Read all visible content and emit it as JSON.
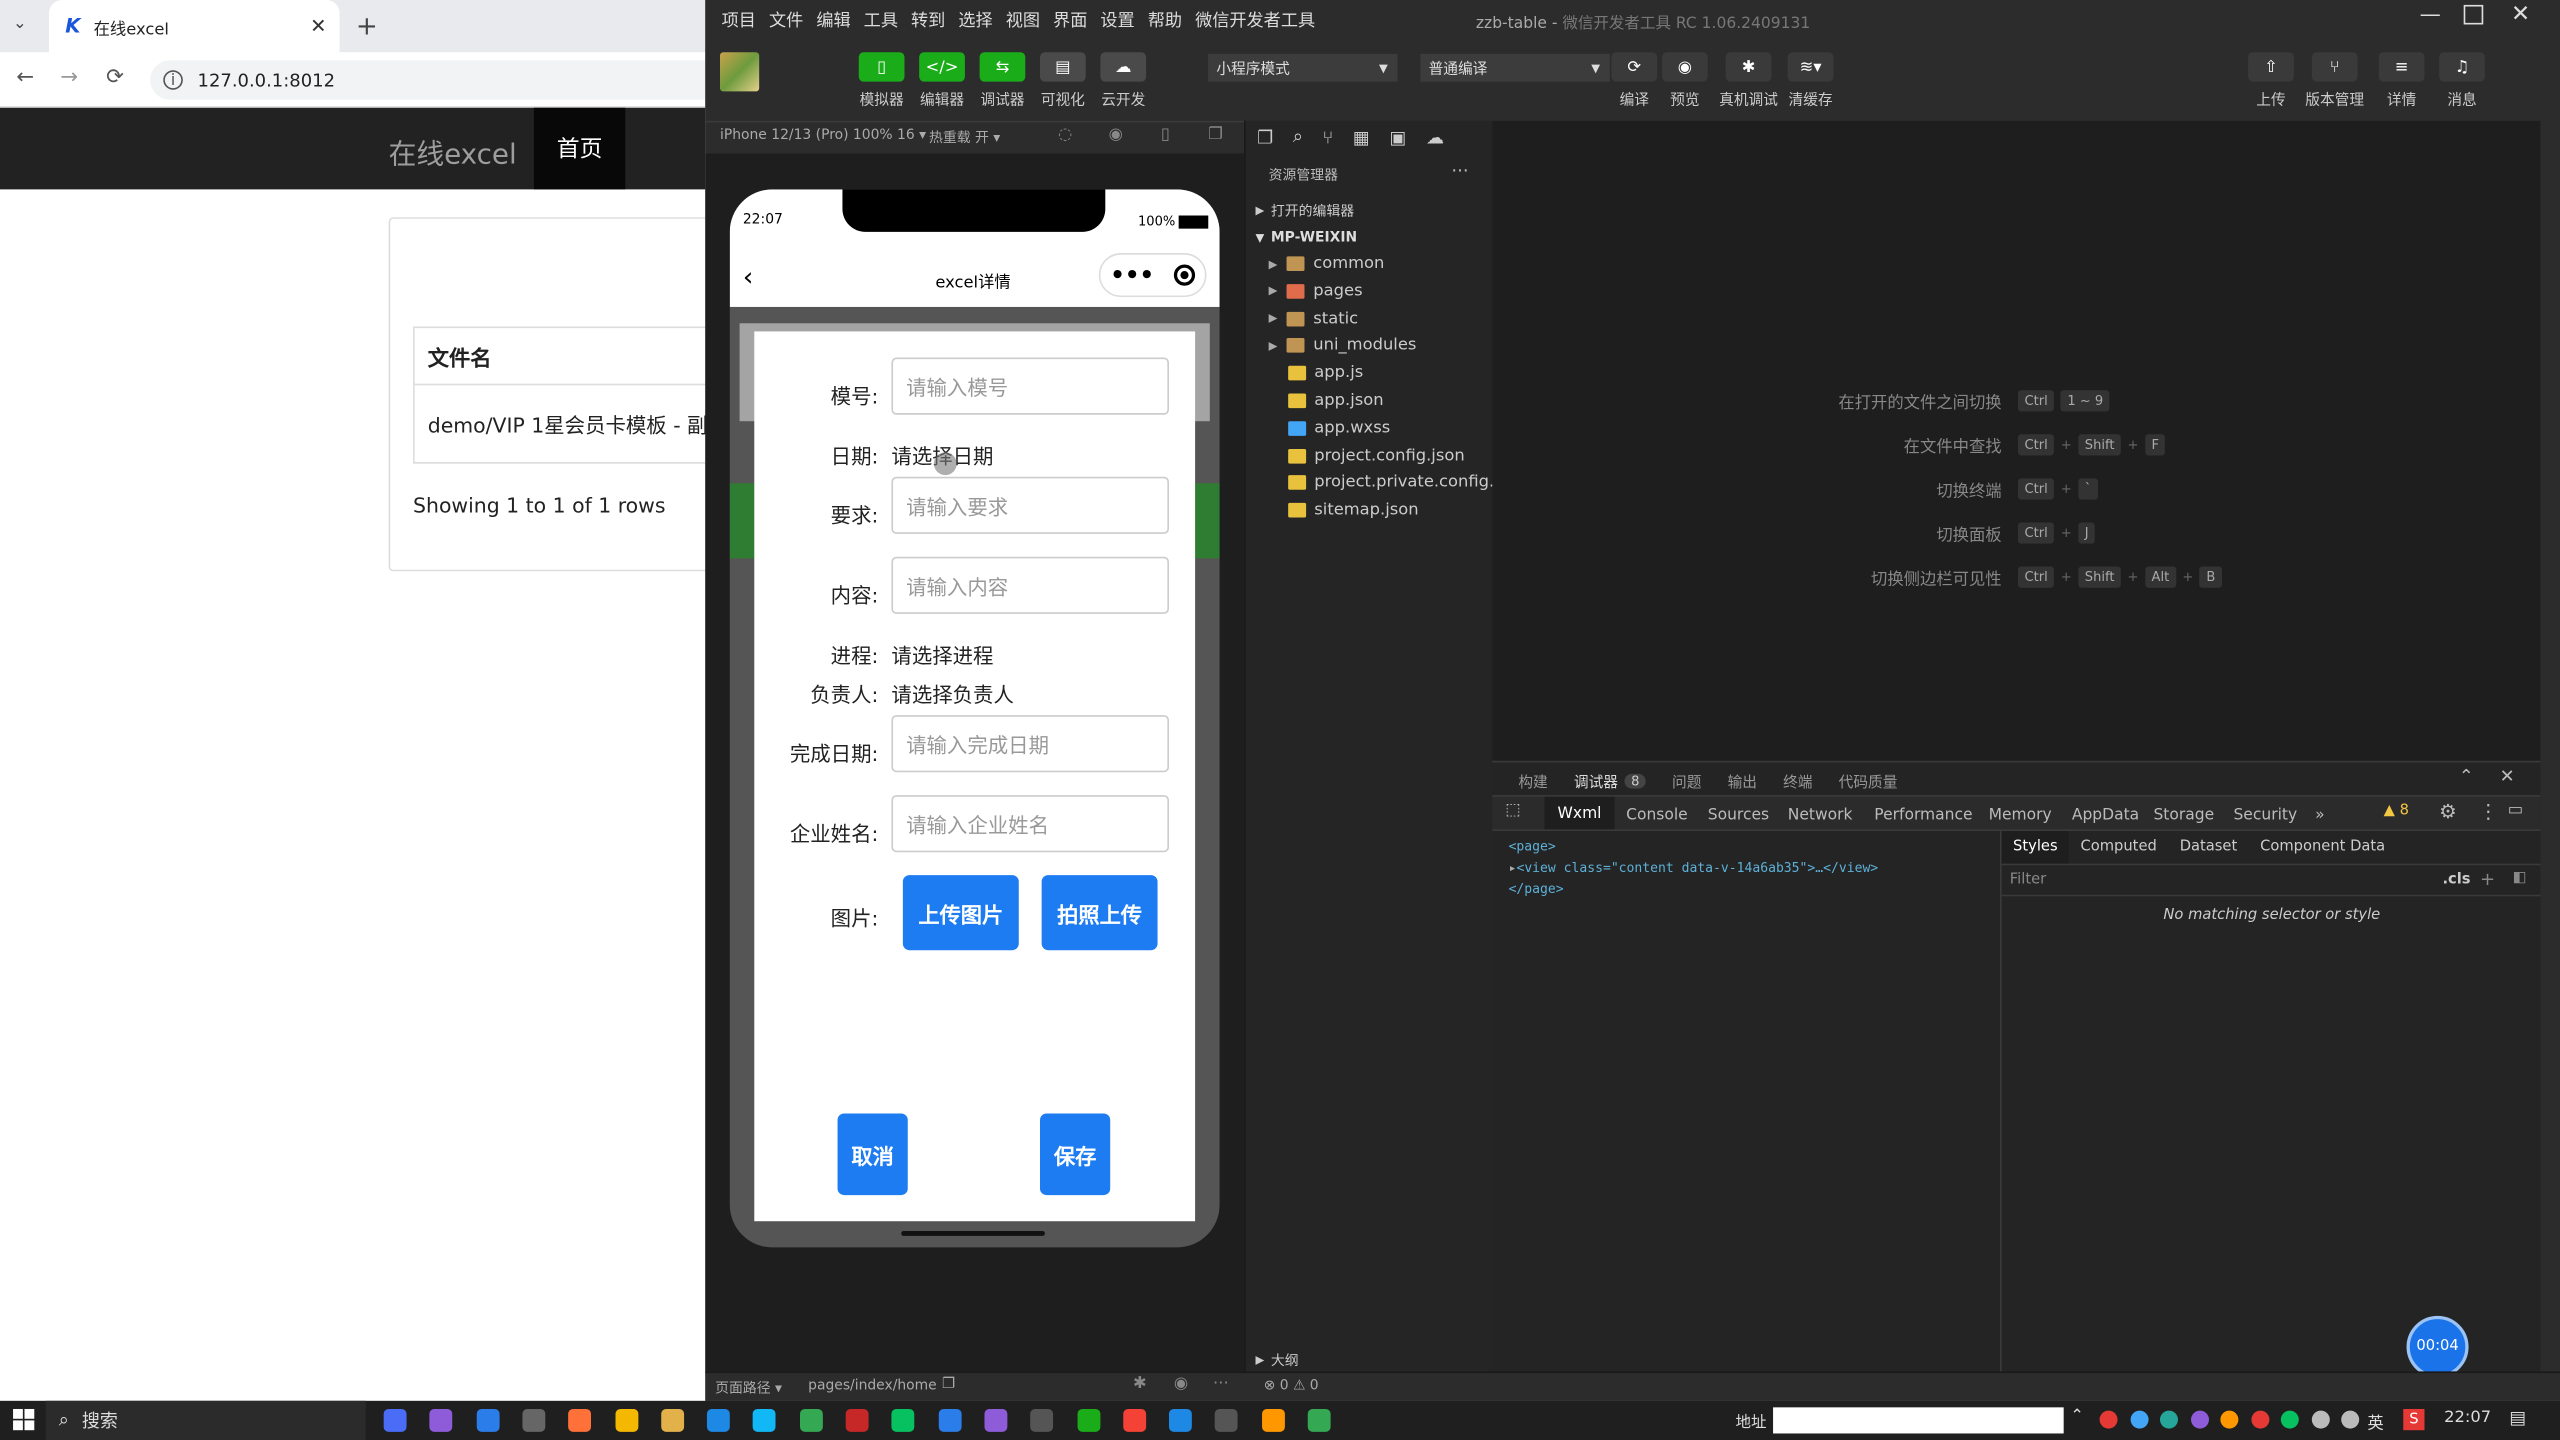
{
  "browser": {
    "tab_title": "在线excel",
    "url": "127.0.0.1:8012"
  },
  "site": {
    "brand": "在线excel",
    "nav_home": "首页",
    "table_header": "文件名",
    "row1": "demo/VIP 1星会员卡模板 - 副",
    "showing": "Showing 1 to 1 of 1 rows"
  },
  "ide": {
    "menu": [
      "项目",
      "文件",
      "编辑",
      "工具",
      "转到",
      "选择",
      "视图",
      "界面",
      "设置",
      "帮助",
      "微信开发者工具"
    ],
    "title": "zzb-table",
    "title_suffix": "微信开发者工具 RC 1.06.2409131",
    "toolbar": {
      "simulator": "模拟器",
      "editor": "编辑器",
      "debugger": "调试器",
      "visual": "可视化",
      "cloud": "云开发",
      "mode": "小程序模式",
      "compile_mode": "普通编译",
      "compile": "编译",
      "preview": "预览",
      "real_debug": "真机调试",
      "clear_cache": "清缓存",
      "upload": "上传",
      "version": "版本管理",
      "details": "详情",
      "messages": "消息"
    },
    "sim_bar": {
      "device": "iPhone 12/13 (Pro) 100% 16 ▾",
      "hot_reload": "热重载 开 ▾"
    },
    "explorer": {
      "title": "资源管理器",
      "open_editors": "打开的编辑器",
      "project": "MP-WEIXIN",
      "items": [
        {
          "name": "common",
          "type": "folder"
        },
        {
          "name": "pages",
          "type": "folder"
        },
        {
          "name": "static",
          "type": "folder"
        },
        {
          "name": "uni_modules",
          "type": "folder"
        },
        {
          "name": "app.js",
          "type": "js"
        },
        {
          "name": "app.json",
          "type": "json"
        },
        {
          "name": "app.wxss",
          "type": "wxss"
        },
        {
          "name": "project.config.json",
          "type": "json"
        },
        {
          "name": "project.private.config.js...",
          "type": "json"
        },
        {
          "name": "sitemap.json",
          "type": "json"
        }
      ],
      "outline": "大纲"
    },
    "shortcuts": [
      {
        "label": "在打开的文件之间切换",
        "keys": [
          "Ctrl",
          "1 ~ 9"
        ]
      },
      {
        "label": "在文件中查找",
        "keys": [
          "Ctrl",
          "+",
          "Shift",
          "+",
          "F"
        ]
      },
      {
        "label": "切换终端",
        "keys": [
          "Ctrl",
          "+",
          "`"
        ]
      },
      {
        "label": "切换面板",
        "keys": [
          "Ctrl",
          "+",
          "J"
        ]
      },
      {
        "label": "切换侧边栏可见性",
        "keys": [
          "Ctrl",
          "+",
          "Shift",
          "+",
          "Alt",
          "+",
          "B"
        ]
      }
    ],
    "panel_tabs": [
      "构建",
      "调试器",
      "问题",
      "输出",
      "终端",
      "代码质量"
    ],
    "panel_badge": "8",
    "devtools_tabs": [
      "Wxml",
      "Console",
      "Sources",
      "Network",
      "Performance",
      "Memory",
      "AppData",
      "Storage",
      "Security",
      "»"
    ],
    "warning_count": "8",
    "wxml": {
      "line1": "<page>",
      "line2_tag": "<view class=\"content data-v-14a6ab35\">…</view>",
      "line3": "</page>"
    },
    "styles_tabs": [
      "Styles",
      "Computed",
      "Dataset",
      "Component Data"
    ],
    "filter_placeholder": "Filter",
    "cls": ".cls",
    "no_match": "No matching selector or style",
    "status": {
      "path_label": "页面路径 ▾",
      "path": "pages/index/home",
      "errors": "⊗ 0 ⚠ 0"
    },
    "timer": "00:04"
  },
  "phone": {
    "time": "22:07",
    "battery": "100%",
    "nav_title": "excel详情",
    "form": {
      "model_label": "模号:",
      "model_ph": "请输入模号",
      "date_label": "日期:",
      "date_value": "请选择日期",
      "req_label": "要求:",
      "req_ph": "请输入要求",
      "content_label": "内容:",
      "content_ph": "请输入内容",
      "progress_label": "进程:",
      "progress_value": "请选择进程",
      "owner_label": "负责人:",
      "owner_value": "请选择负责人",
      "finish_label": "完成日期:",
      "finish_ph": "请输入完成日期",
      "company_label": "企业姓名:",
      "company_ph": "请输入企业姓名",
      "image_label": "图片:",
      "upload_btn": "上传图片",
      "camera_btn": "拍照上传",
      "cancel_btn": "取消",
      "save_btn": "保存"
    }
  },
  "taskbar": {
    "search": "搜索",
    "address": "地址",
    "ime": "英",
    "clock": "22:07"
  }
}
